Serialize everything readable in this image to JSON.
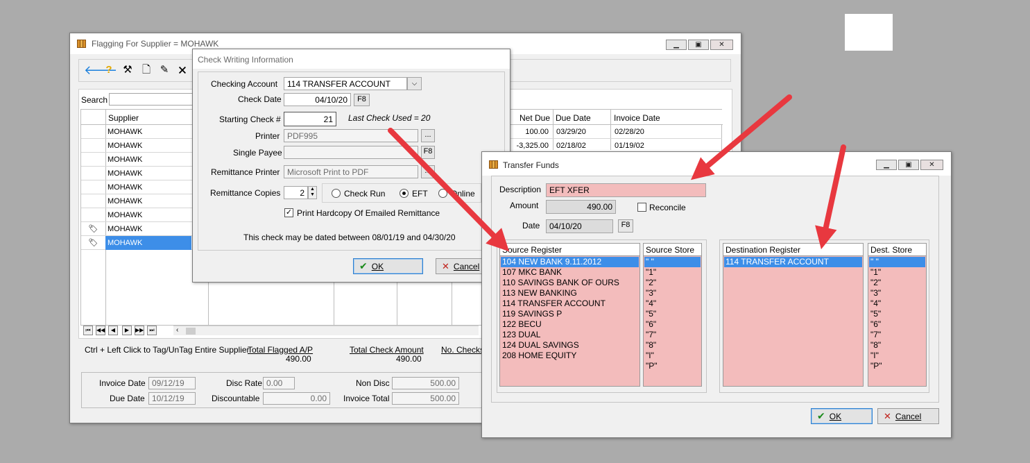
{
  "main": {
    "title": "Flagging For Supplier = MOHAWK",
    "search_label": "Search",
    "columns": {
      "supplier": "Supplier",
      "net_due": "Net Due",
      "due_date": "Due Date",
      "invoice_date": "Invoice Date"
    },
    "rows": [
      {
        "supplier": "MOHAWK",
        "net_due": "100.00",
        "due_date": "03/29/20",
        "invoice_date": "02/28/20"
      },
      {
        "supplier": "MOHAWK",
        "net_due": "-3,325.00",
        "due_date": "02/18/02",
        "invoice_date": "01/19/02"
      },
      {
        "supplier": "MOHAWK"
      },
      {
        "supplier": "MOHAWK"
      },
      {
        "supplier": "MOHAWK"
      },
      {
        "supplier": "MOHAWK"
      },
      {
        "supplier": "MOHAWK"
      },
      {
        "supplier": "MOHAWK"
      },
      {
        "supplier": "MOHAWK"
      }
    ],
    "ctrl_hint": "Ctrl + Left Click to Tag/UnTag Entire Supplier",
    "total_flagged_label": "Total Flagged A/P",
    "total_flagged_value": "490.00",
    "total_check_label": "Total Check Amount",
    "total_check_value": "490.00",
    "no_checks_label": "No. Checks",
    "invoice_date_label": "Invoice Date",
    "invoice_date_value": "09/12/19",
    "due_date_label": "Due Date",
    "due_date_value": "10/12/19",
    "disc_rate_label": "Disc Rate",
    "disc_rate_value": "0.00",
    "discountable_label": "Discountable",
    "discountable_value": "0.00",
    "non_disc_label": "Non Disc",
    "non_disc_value": "500.00",
    "invoice_total_label": "Invoice Total",
    "invoice_total_value": "500.00"
  },
  "check": {
    "title": "Check Writing Information",
    "checking_account_label": "Checking Account",
    "checking_account_value": "114  TRANSFER ACCOUNT",
    "check_date_label": "Check Date",
    "check_date_value": "04/10/20",
    "f8": "F8",
    "starting_check_label": "Starting Check #",
    "starting_check_value": "21",
    "last_check_used": "Last Check Used = 20",
    "printer_label": "Printer",
    "printer_value": "PDF995",
    "single_payee_label": "Single Payee",
    "remittance_printer_label": "Remittance Printer",
    "remittance_printer_value": "Microsoft Print to PDF",
    "remittance_copies_label": "Remittance Copies",
    "remittance_copies_value": "2",
    "radio_check_run": "Check Run",
    "radio_eft": "EFT",
    "radio_online": "Online",
    "print_hardcopy": "Print Hardcopy Of Emailed Remittance",
    "date_range": "This check may be dated between 08/01/19 and 04/30/20",
    "ok": "OK",
    "cancel": "Cancel",
    "ellipsis": "..."
  },
  "transfer": {
    "title": "Transfer Funds",
    "description_label": "Description",
    "description_value": "EFT XFER",
    "amount_label": "Amount",
    "amount_value": "490.00",
    "reconcile_label": "Reconcile",
    "date_label": "Date",
    "date_value": "04/10/20",
    "f8": "F8",
    "source_register_label": "Source Register",
    "source_store_label": "Source Store",
    "dest_register_label": "Destination Register",
    "dest_store_label": "Dest. Store",
    "source_registers": [
      "104  NEW BANK 9.11.2012",
      "107  MKC BANK",
      "110  SAVINGS BANK OF OURS",
      "113  NEW BANKING",
      "114  TRANSFER ACCOUNT",
      "119  SAVINGS P",
      "122  BECU",
      "123  DUAL",
      "124  DUAL SAVINGS",
      "208  HOME EQUITY"
    ],
    "source_stores": [
      "\" \"",
      "\"1\"",
      "\"2\"",
      "\"3\"",
      "\"4\"",
      "\"5\"",
      "\"6\"",
      "\"7\"",
      "\"8\"",
      "\"I\"",
      "\"P\""
    ],
    "dest_registers": [
      "114  TRANSFER ACCOUNT"
    ],
    "dest_stores": [
      "\" \"",
      "\"1\"",
      "\"2\"",
      "\"3\"",
      "\"4\"",
      "\"5\"",
      "\"6\"",
      "\"7\"",
      "\"8\"",
      "\"I\"",
      "\"P\""
    ],
    "ok": "OK",
    "cancel": "Cancel"
  },
  "colors": {
    "arrow": "#e8383f",
    "selection": "#3d8ee8",
    "pink": "#f3bcbc"
  }
}
